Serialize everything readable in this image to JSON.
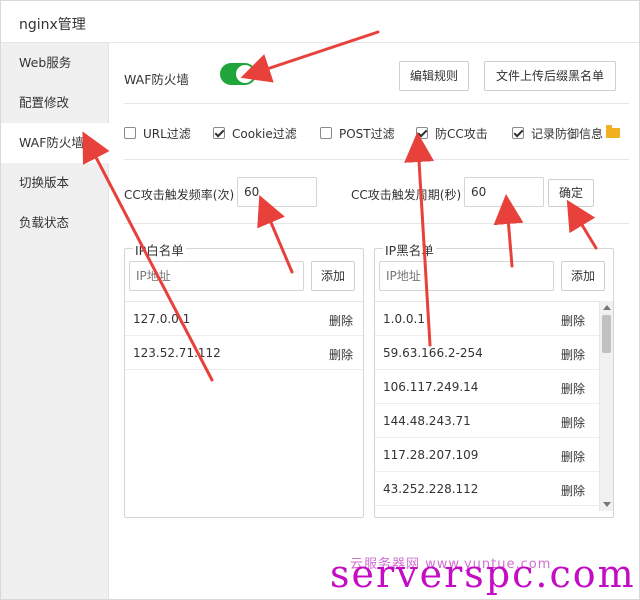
{
  "window": {
    "title": "nginx管理"
  },
  "sidebar": {
    "items": [
      {
        "label": "Web服务"
      },
      {
        "label": "配置修改"
      },
      {
        "label": "WAF防火墙"
      },
      {
        "label": "切换版本"
      },
      {
        "label": "负载状态"
      }
    ],
    "active_index": 2
  },
  "waf": {
    "label": "WAF防火墙",
    "enabled": true,
    "edit_rules_button": "编辑规则",
    "upload_button": "文件上传后缀黑名单"
  },
  "options": {
    "url_filter": {
      "label": "URL过滤",
      "checked": false
    },
    "cookie_filter": {
      "label": "Cookie过滤",
      "checked": true
    },
    "post_filter": {
      "label": "POST过滤",
      "checked": false
    },
    "anti_cc": {
      "label": "防CC攻击",
      "checked": true
    },
    "log_defense": {
      "label": "记录防御信息",
      "checked": true
    }
  },
  "cc": {
    "freq_label": "CC攻击触发频率(次)",
    "freq_value": "60",
    "period_label": "CC攻击触发周期(秒)",
    "period_value": "60",
    "confirm_button": "确定"
  },
  "whitelist": {
    "title": "IP白名单",
    "placeholder": "IP地址",
    "add_button": "添加",
    "delete_label": "删除",
    "items": [
      "127.0.0.1",
      "123.52.71.112"
    ]
  },
  "blacklist": {
    "title": "IP黑名单",
    "placeholder": "IP地址",
    "add_button": "添加",
    "delete_label": "删除",
    "items": [
      "1.0.0.1",
      "59.63.166.2-254",
      "106.117.249.14",
      "144.48.243.71",
      "117.28.207.109",
      "43.252.228.112"
    ]
  },
  "watermark": {
    "small": "云服务器网 www.yuntue.com",
    "large": "serverspc.com"
  },
  "colors": {
    "toggle_on": "#20a53a",
    "annotation_arrow": "#e8413b",
    "watermark": "#c000c0"
  }
}
